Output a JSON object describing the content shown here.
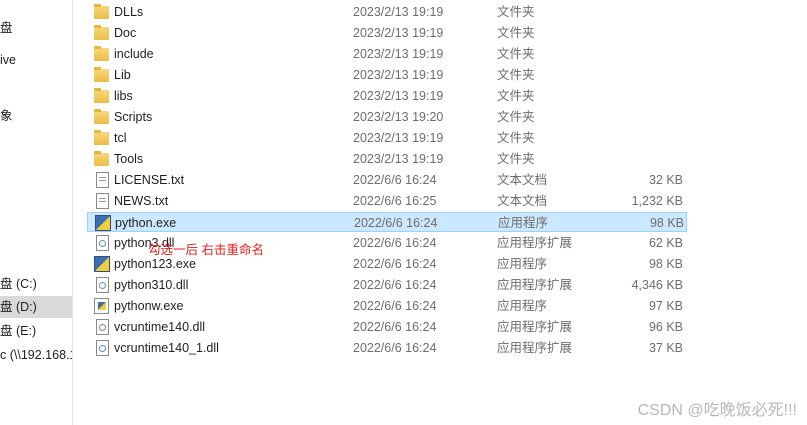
{
  "nav": {
    "items": [
      {
        "label": "盘"
      },
      {
        "label": "ive"
      },
      {
        "label": "象"
      },
      {
        "label": "盘 (C:)"
      },
      {
        "label": "盘 (D:)"
      },
      {
        "label": "盘 (E:)"
      },
      {
        "label": "c (\\\\192.168.1"
      }
    ]
  },
  "files": [
    {
      "name": "DLLs",
      "date": "2023/2/13 19:19",
      "type": "文件夹",
      "size": "",
      "icon": "folder-icon"
    },
    {
      "name": "Doc",
      "date": "2023/2/13 19:19",
      "type": "文件夹",
      "size": "",
      "icon": "folder-icon"
    },
    {
      "name": "include",
      "date": "2023/2/13 19:19",
      "type": "文件夹",
      "size": "",
      "icon": "folder-icon"
    },
    {
      "name": "Lib",
      "date": "2023/2/13 19:19",
      "type": "文件夹",
      "size": "",
      "icon": "folder-icon"
    },
    {
      "name": "libs",
      "date": "2023/2/13 19:19",
      "type": "文件夹",
      "size": "",
      "icon": "folder-icon"
    },
    {
      "name": "Scripts",
      "date": "2023/2/13 19:20",
      "type": "文件夹",
      "size": "",
      "icon": "folder-icon"
    },
    {
      "name": "tcl",
      "date": "2023/2/13 19:19",
      "type": "文件夹",
      "size": "",
      "icon": "folder-icon"
    },
    {
      "name": "Tools",
      "date": "2023/2/13 19:19",
      "type": "文件夹",
      "size": "",
      "icon": "folder-icon"
    },
    {
      "name": "LICENSE.txt",
      "date": "2022/6/6 16:24",
      "type": "文本文档",
      "size": "32 KB",
      "icon": "text-file-icon"
    },
    {
      "name": "NEWS.txt",
      "date": "2022/6/6 16:25",
      "type": "文本文档",
      "size": "1,232 KB",
      "icon": "text-file-icon"
    },
    {
      "name": "python.exe",
      "date": "2022/6/6 16:24",
      "type": "应用程序",
      "size": "98 KB",
      "icon": "python-icon"
    },
    {
      "name": "python3.dll",
      "date": "2022/6/6 16:24",
      "type": "应用程序扩展",
      "size": "62 KB",
      "icon": "dll-icon"
    },
    {
      "name": "python123.exe",
      "date": "2022/6/6 16:24",
      "type": "应用程序",
      "size": "98 KB",
      "icon": "python-icon"
    },
    {
      "name": "python310.dll",
      "date": "2022/6/6 16:24",
      "type": "应用程序扩展",
      "size": "4,346 KB",
      "icon": "dll-icon"
    },
    {
      "name": "pythonw.exe",
      "date": "2022/6/6 16:24",
      "type": "应用程序",
      "size": "97 KB",
      "icon": "pythonw-icon"
    },
    {
      "name": "vcruntime140.dll",
      "date": "2022/6/6 16:24",
      "type": "应用程序扩展",
      "size": "96 KB",
      "icon": "dll-icon"
    },
    {
      "name": "vcruntime140_1.dll",
      "date": "2022/6/6 16:24",
      "type": "应用程序扩展",
      "size": "37 KB",
      "icon": "dll-icon"
    }
  ],
  "annotation": "勾选一后 右击重命名",
  "watermark": "CSDN @吃晚饭必死!!!",
  "colors": {
    "selection": "#cce8ff",
    "annotation": "#e02020"
  }
}
